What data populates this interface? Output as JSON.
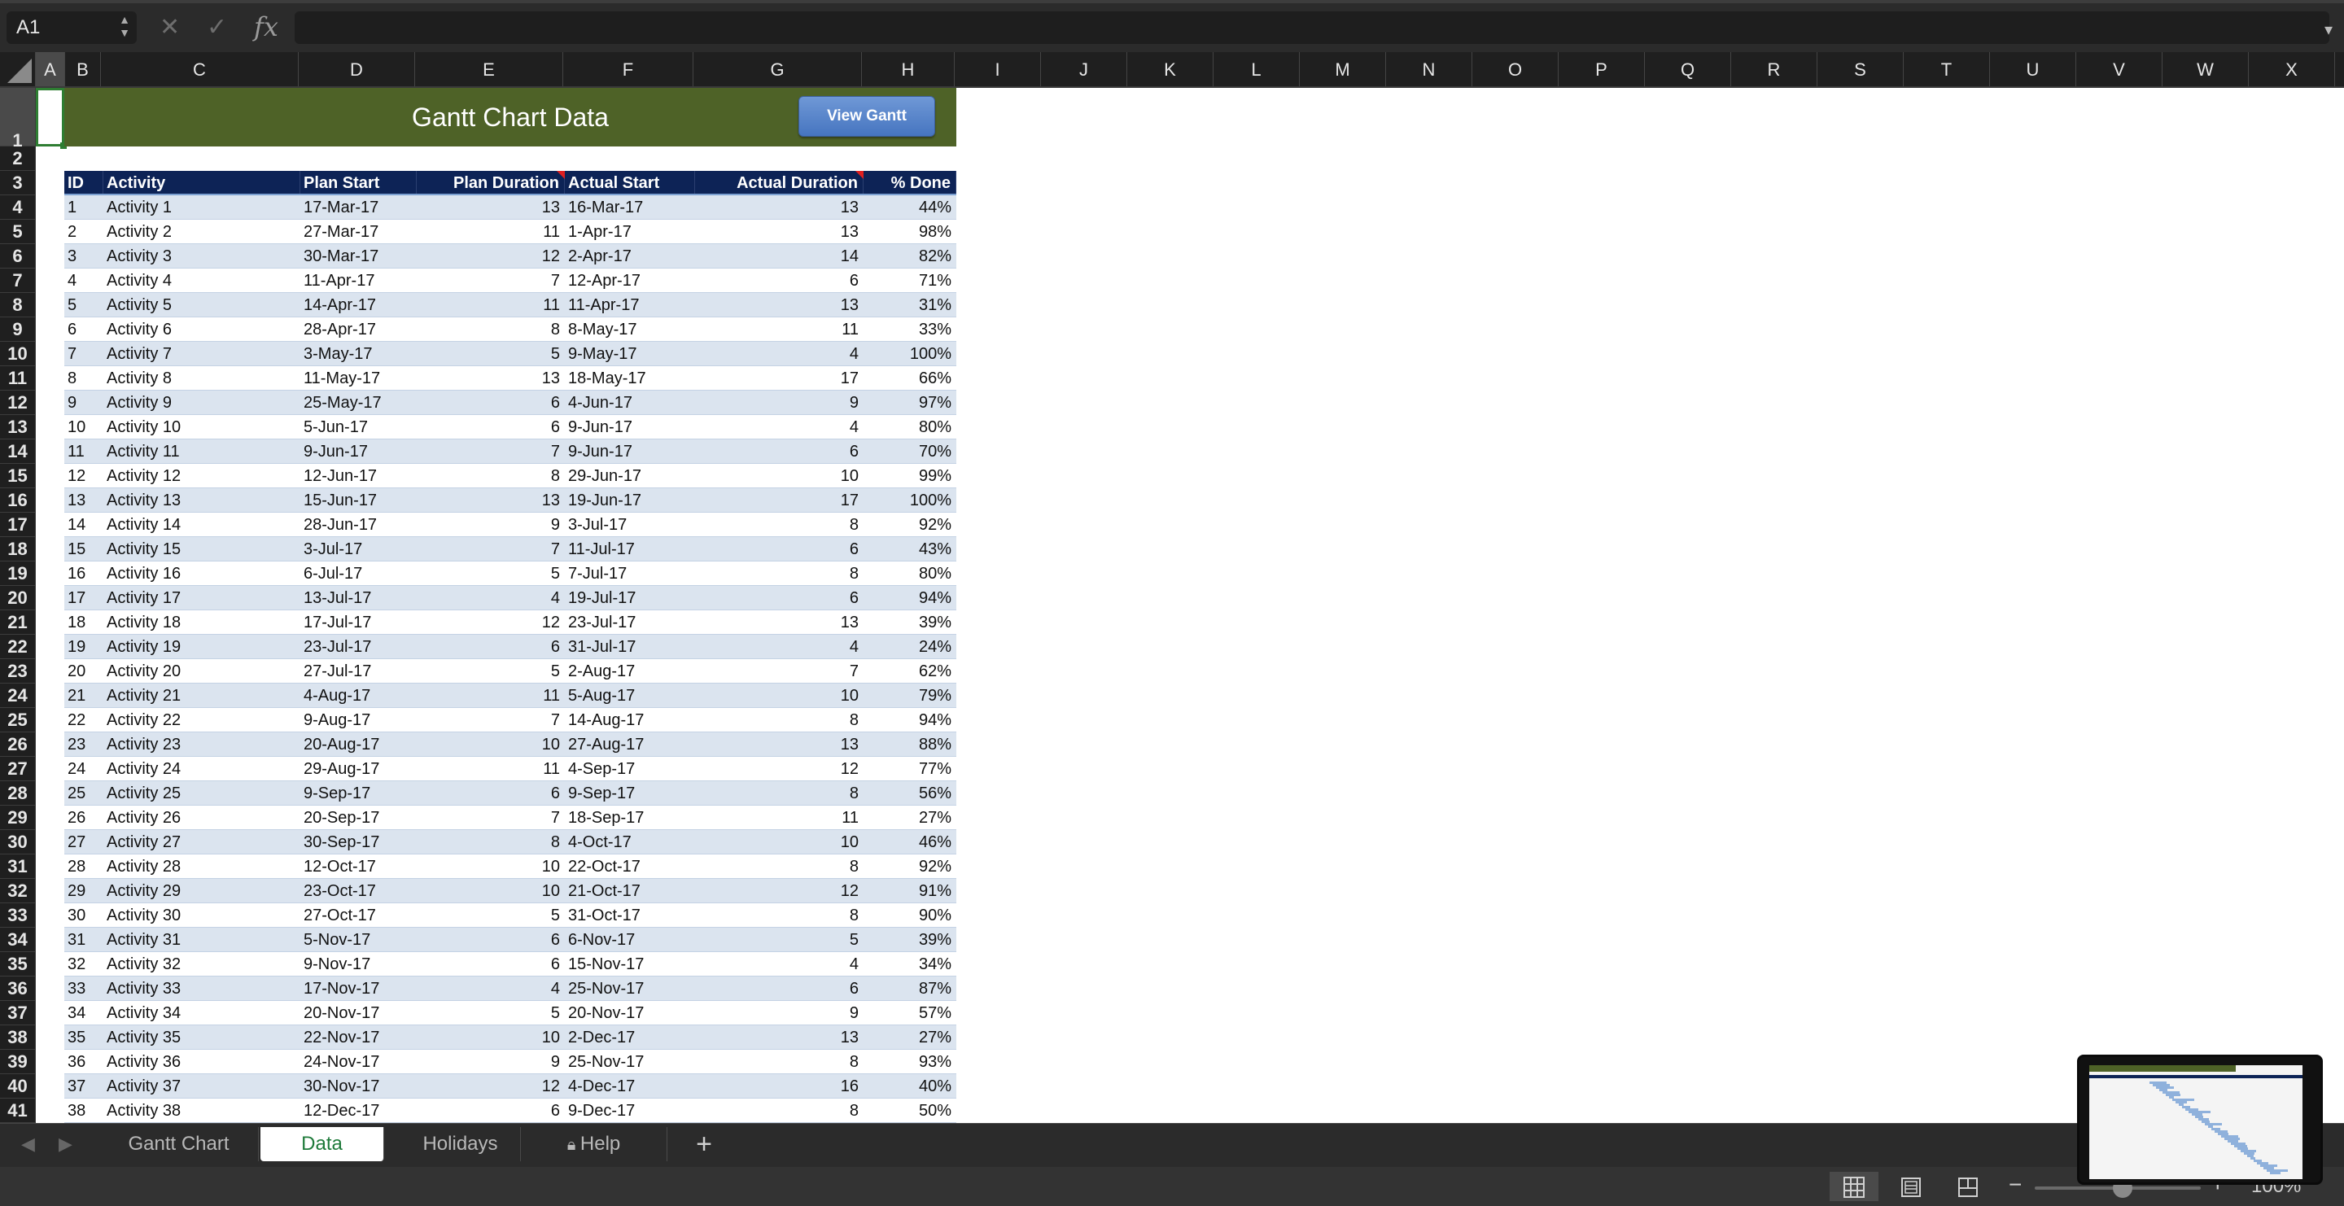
{
  "formula_bar": {
    "name_box": "A1",
    "cancel_glyph": "✕",
    "enter_glyph": "✓",
    "fx_label": "fx",
    "formula": ""
  },
  "columns": [
    "A",
    "B",
    "C",
    "D",
    "E",
    "F",
    "G",
    "H",
    "I",
    "J",
    "K",
    "L",
    "M",
    "N",
    "O",
    "P",
    "Q",
    "R",
    "S",
    "T",
    "U",
    "V",
    "W",
    "X"
  ],
  "selected_column": "A",
  "selected_row": "1",
  "rows": [
    "1",
    "2",
    "3",
    "4",
    "5",
    "6",
    "7",
    "8",
    "9",
    "10",
    "11",
    "12",
    "13",
    "14",
    "15",
    "16",
    "17",
    "18",
    "19",
    "20",
    "21",
    "22",
    "23",
    "24",
    "25",
    "26",
    "27",
    "28",
    "29",
    "30",
    "31",
    "32",
    "33",
    "34",
    "35",
    "36",
    "37",
    "38",
    "39",
    "40",
    "41"
  ],
  "sheet": {
    "title": "Gantt Chart Data",
    "view_button": "View Gantt",
    "headers": {
      "id": "ID",
      "activity": "Activity",
      "plan_start": "Plan Start",
      "plan_duration": "Plan Duration",
      "actual_start": "Actual Start",
      "actual_duration": "Actual Duration",
      "pct_done": "% Done"
    },
    "records": [
      [
        "1",
        "Activity 1",
        "17-Mar-17",
        "13",
        "16-Mar-17",
        "13",
        "44%"
      ],
      [
        "2",
        "Activity 2",
        "27-Mar-17",
        "11",
        "1-Apr-17",
        "13",
        "98%"
      ],
      [
        "3",
        "Activity 3",
        "30-Mar-17",
        "12",
        "2-Apr-17",
        "14",
        "82%"
      ],
      [
        "4",
        "Activity 4",
        "11-Apr-17",
        "7",
        "12-Apr-17",
        "6",
        "71%"
      ],
      [
        "5",
        "Activity 5",
        "14-Apr-17",
        "11",
        "11-Apr-17",
        "13",
        "31%"
      ],
      [
        "6",
        "Activity 6",
        "28-Apr-17",
        "8",
        "8-May-17",
        "11",
        "33%"
      ],
      [
        "7",
        "Activity 7",
        "3-May-17",
        "5",
        "9-May-17",
        "4",
        "100%"
      ],
      [
        "8",
        "Activity 8",
        "11-May-17",
        "13",
        "18-May-17",
        "17",
        "66%"
      ],
      [
        "9",
        "Activity 9",
        "25-May-17",
        "6",
        "4-Jun-17",
        "9",
        "97%"
      ],
      [
        "10",
        "Activity 10",
        "5-Jun-17",
        "6",
        "9-Jun-17",
        "4",
        "80%"
      ],
      [
        "11",
        "Activity 11",
        "9-Jun-17",
        "7",
        "9-Jun-17",
        "6",
        "70%"
      ],
      [
        "12",
        "Activity 12",
        "12-Jun-17",
        "8",
        "29-Jun-17",
        "10",
        "99%"
      ],
      [
        "13",
        "Activity 13",
        "15-Jun-17",
        "13",
        "19-Jun-17",
        "17",
        "100%"
      ],
      [
        "14",
        "Activity 14",
        "28-Jun-17",
        "9",
        "3-Jul-17",
        "8",
        "92%"
      ],
      [
        "15",
        "Activity 15",
        "3-Jul-17",
        "7",
        "11-Jul-17",
        "6",
        "43%"
      ],
      [
        "16",
        "Activity 16",
        "6-Jul-17",
        "5",
        "7-Jul-17",
        "8",
        "80%"
      ],
      [
        "17",
        "Activity 17",
        "13-Jul-17",
        "4",
        "19-Jul-17",
        "6",
        "94%"
      ],
      [
        "18",
        "Activity 18",
        "17-Jul-17",
        "12",
        "23-Jul-17",
        "13",
        "39%"
      ],
      [
        "19",
        "Activity 19",
        "23-Jul-17",
        "6",
        "31-Jul-17",
        "4",
        "24%"
      ],
      [
        "20",
        "Activity 20",
        "27-Jul-17",
        "5",
        "2-Aug-17",
        "7",
        "62%"
      ],
      [
        "21",
        "Activity 21",
        "4-Aug-17",
        "11",
        "5-Aug-17",
        "10",
        "79%"
      ],
      [
        "22",
        "Activity 22",
        "9-Aug-17",
        "7",
        "14-Aug-17",
        "8",
        "94%"
      ],
      [
        "23",
        "Activity 23",
        "20-Aug-17",
        "10",
        "27-Aug-17",
        "13",
        "88%"
      ],
      [
        "24",
        "Activity 24",
        "29-Aug-17",
        "11",
        "4-Sep-17",
        "12",
        "77%"
      ],
      [
        "25",
        "Activity 25",
        "9-Sep-17",
        "6",
        "9-Sep-17",
        "8",
        "56%"
      ],
      [
        "26",
        "Activity 26",
        "20-Sep-17",
        "7",
        "18-Sep-17",
        "11",
        "27%"
      ],
      [
        "27",
        "Activity 27",
        "30-Sep-17",
        "8",
        "4-Oct-17",
        "10",
        "46%"
      ],
      [
        "28",
        "Activity 28",
        "12-Oct-17",
        "10",
        "22-Oct-17",
        "8",
        "92%"
      ],
      [
        "29",
        "Activity 29",
        "23-Oct-17",
        "10",
        "21-Oct-17",
        "12",
        "91%"
      ],
      [
        "30",
        "Activity 30",
        "27-Oct-17",
        "5",
        "31-Oct-17",
        "8",
        "90%"
      ],
      [
        "31",
        "Activity 31",
        "5-Nov-17",
        "6",
        "6-Nov-17",
        "5",
        "39%"
      ],
      [
        "32",
        "Activity 32",
        "9-Nov-17",
        "6",
        "15-Nov-17",
        "4",
        "34%"
      ],
      [
        "33",
        "Activity 33",
        "17-Nov-17",
        "4",
        "25-Nov-17",
        "6",
        "87%"
      ],
      [
        "34",
        "Activity 34",
        "20-Nov-17",
        "5",
        "20-Nov-17",
        "9",
        "57%"
      ],
      [
        "35",
        "Activity 35",
        "22-Nov-17",
        "10",
        "2-Dec-17",
        "13",
        "27%"
      ],
      [
        "36",
        "Activity 36",
        "24-Nov-17",
        "9",
        "25-Nov-17",
        "8",
        "93%"
      ],
      [
        "37",
        "Activity 37",
        "30-Nov-17",
        "12",
        "4-Dec-17",
        "16",
        "40%"
      ],
      [
        "38",
        "Activity 38",
        "12-Dec-17",
        "6",
        "9-Dec-17",
        "8",
        "50%"
      ]
    ]
  },
  "tabs": [
    {
      "label": "Gantt Chart",
      "active": false,
      "locked": false
    },
    {
      "label": "Data",
      "active": true,
      "locked": false
    },
    {
      "label": "Holidays",
      "active": false,
      "locked": false
    },
    {
      "label": "Help",
      "active": false,
      "locked": true
    }
  ],
  "add_sheet_glyph": "+",
  "status_bar": {
    "zoom": "100%",
    "zoom_minus": "−",
    "zoom_plus": "+"
  },
  "colors": {
    "title_banner": "#4e6227",
    "table_header": "#0d2356",
    "band_row": "#dbe4ef",
    "view_button": "#4675c0",
    "active_tab_text": "#1e7a3a"
  },
  "icons": {
    "normal_view": "grid-icon",
    "page_layout": "page-layout-icon",
    "page_break": "page-break-icon",
    "lock": "lock-icon"
  }
}
